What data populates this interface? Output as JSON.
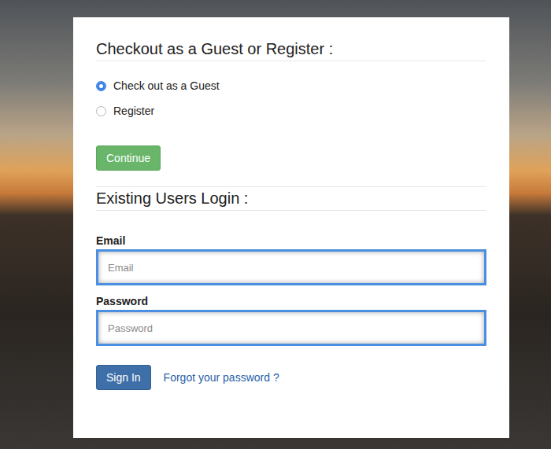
{
  "checkout": {
    "heading": "Checkout as a Guest or Register :",
    "options": [
      {
        "label": "Check out as a Guest",
        "selected": true
      },
      {
        "label": "Register",
        "selected": false
      }
    ],
    "button": "Continue"
  },
  "login": {
    "heading": "Existing Users Login :",
    "fields": [
      {
        "label": "Email",
        "placeholder": "Email",
        "focused": true
      },
      {
        "label": "Password",
        "placeholder": "Password",
        "focused": true
      }
    ],
    "button": "Sign In",
    "link": "Forgot your password ?"
  }
}
